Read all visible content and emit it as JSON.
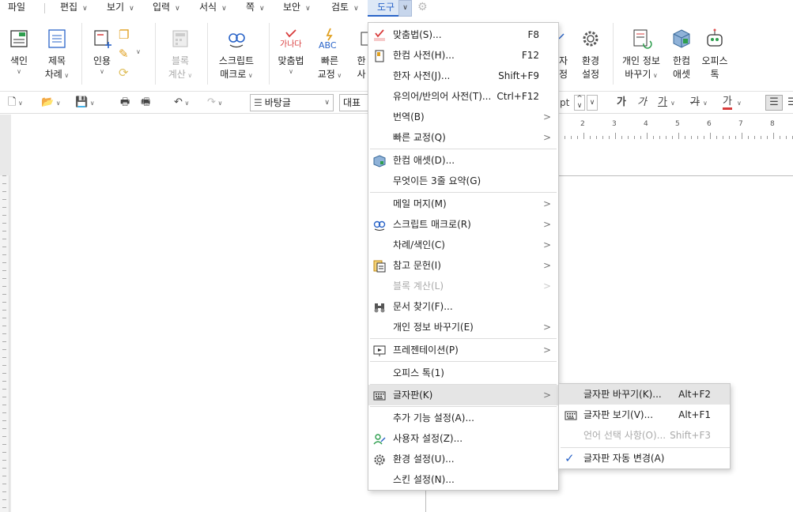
{
  "menubar": {
    "items": [
      "파일",
      "편집",
      "보기",
      "입력",
      "서식",
      "쪽",
      "보안",
      "검토",
      "도구"
    ],
    "active": "도구"
  },
  "ribbon": {
    "index_label": "색인",
    "toc_label_1": "제목",
    "toc_label_2": "차례",
    "cite_label": "인용",
    "block_calc_1": "블록",
    "block_calc_2": "계산",
    "script_macro_1": "스크립트",
    "script_macro_2": "매크로",
    "spell_label": "맞춤법",
    "quick_fix_1": "빠른",
    "quick_fix_2": "교정",
    "hanja_1": "한",
    "hanja_2": "사",
    "charmap_1": "자",
    "charmap_2": "정",
    "env_1": "환경",
    "env_2": "설정",
    "privacy_1": "개인 정보",
    "privacy_2": "바꾸기",
    "asset_1": "한컴",
    "asset_2": "애셋",
    "office_1": "오피스",
    "office_2": "톡",
    "spell_icon_text": "가나다",
    "abc_icon_text": "ABC"
  },
  "toolbar": {
    "style_value": "바탕글",
    "font_value": "대표",
    "size_unit": "pt",
    "bold": "가",
    "italic": "가",
    "underline": "가",
    "strike": "가",
    "color": "가"
  },
  "ruler": {
    "labels": [
      "2",
      "3",
      "4",
      "5",
      "6",
      "7",
      "8"
    ]
  },
  "tools_menu": {
    "items": [
      {
        "label": "맞춤법(S)...",
        "shortcut": "F8"
      },
      {
        "label": "한컴 사전(H)...",
        "shortcut": "F12"
      },
      {
        "label": "한자 사전(J)...",
        "shortcut": "Shift+F9"
      },
      {
        "label": "유의어/반의어 사전(T)...",
        "shortcut": "Ctrl+F12"
      },
      {
        "label": "번역(B)"
      },
      {
        "label": "빠른 교정(Q)"
      },
      {
        "label": "한컴 애셋(D)..."
      },
      {
        "label": "무엇이든 3줄 요약(G)"
      },
      {
        "label": "메일 머지(M)"
      },
      {
        "label": "스크립트 매크로(R)"
      },
      {
        "label": "차례/색인(C)"
      },
      {
        "label": "참고 문헌(I)"
      },
      {
        "label": "블록 계산(L)"
      },
      {
        "label": "문서 찾기(F)..."
      },
      {
        "label": "개인 정보 바꾸기(E)"
      },
      {
        "label": "프레젠테이션(P)"
      },
      {
        "label": "오피스 톡(1)"
      },
      {
        "label": "글자판(K)"
      },
      {
        "label": "추가 기능 설정(A)..."
      },
      {
        "label": "사용자 설정(Z)..."
      },
      {
        "label": "환경 설정(U)..."
      },
      {
        "label": "스킨 설정(N)..."
      }
    ]
  },
  "keyboard_submenu": {
    "items": [
      {
        "label": "글자판 바꾸기(K)...",
        "shortcut": "Alt+F2"
      },
      {
        "label": "글자판 보기(V)...",
        "shortcut": "Alt+F1"
      },
      {
        "label": "언어 선택 사항(O)...",
        "shortcut": "Shift+F3"
      },
      {
        "label": "글자판 자동 변경(A)"
      }
    ]
  },
  "colors": {
    "accent": "#2a64c8",
    "spell_red": "#d83b3b",
    "menu_highlight": "#e5e5e5"
  }
}
